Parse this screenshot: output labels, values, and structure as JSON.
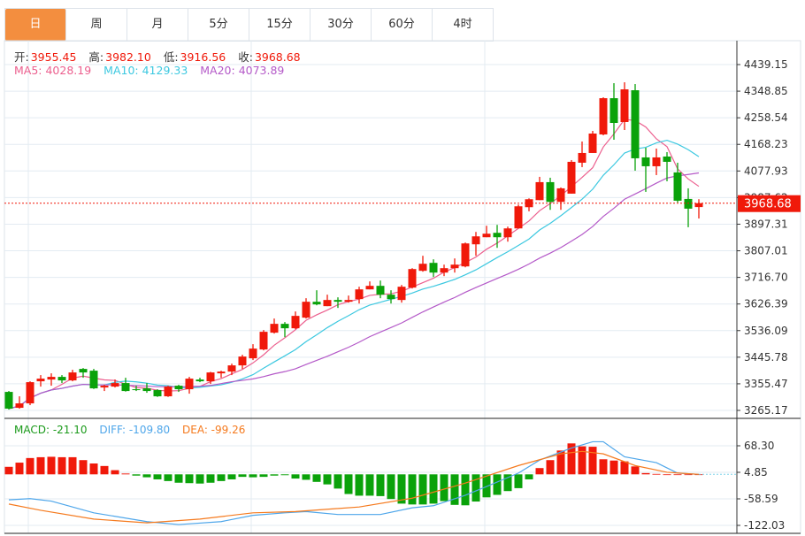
{
  "tabs": [
    "日",
    "周",
    "月",
    "5分",
    "15分",
    "30分",
    "60分",
    "4时"
  ],
  "active_tab": 0,
  "ohlc_legend": {
    "open_label": "开:",
    "open": "3955.45",
    "high_label": "高:",
    "high": "3982.10",
    "low_label": "低:",
    "low": "3916.56",
    "close_label": "收:",
    "close": "3968.68"
  },
  "ma_legend": {
    "ma5": "MA5: 4028.19",
    "ma10": "MA10: 4129.33",
    "ma20": "MA20: 4073.89"
  },
  "macd_legend": {
    "macd": "MACD: -21.10",
    "diff": "DIFF: -109.80",
    "dea": "DEA: -99.26"
  },
  "colors": {
    "up": "#f0190a",
    "down": "#0aa20a",
    "ma5": "#ec5f8e",
    "ma10": "#3cc8e0",
    "ma20": "#b459c8",
    "diff": "#4ea6ea",
    "dea": "#f57a1e",
    "active_tab": "#f38e3f"
  },
  "chart_data": {
    "type": "candlestick",
    "price_axis_ticks": [
      "4439.15",
      "4348.85",
      "4258.54",
      "4168.23",
      "4077.93",
      "3987.62",
      "3897.31",
      "3807.01",
      "3716.70",
      "3626.39",
      "3536.09",
      "3445.78",
      "3355.47",
      "3265.17"
    ],
    "price_range": [
      3265.17,
      4439.15
    ],
    "current_price": "3968.68",
    "candles": [
      [
        3328,
        3271,
        3331,
        3268
      ],
      [
        3274,
        3289,
        3313,
        3271
      ],
      [
        3289,
        3361,
        3364,
        3283
      ],
      [
        3364,
        3373,
        3385,
        3346
      ],
      [
        3370,
        3379,
        3391,
        3349
      ],
      [
        3379,
        3367,
        3385,
        3358
      ],
      [
        3367,
        3394,
        3403,
        3364
      ],
      [
        3406,
        3394,
        3409,
        3376
      ],
      [
        3400,
        3340,
        3406,
        3338
      ],
      [
        3343,
        3349,
        3352,
        3331
      ],
      [
        3346,
        3358,
        3370,
        3343
      ],
      [
        3358,
        3331,
        3376,
        3329
      ],
      [
        3337,
        3334,
        3349,
        3331
      ],
      [
        3340,
        3331,
        3358,
        3325
      ],
      [
        3334,
        3313,
        3337,
        3311
      ],
      [
        3313,
        3346,
        3349,
        3311
      ],
      [
        3349,
        3337,
        3352,
        3328
      ],
      [
        3337,
        3373,
        3379,
        3322
      ],
      [
        3370,
        3364,
        3376,
        3361
      ],
      [
        3364,
        3394,
        3396,
        3355
      ],
      [
        3391,
        3397,
        3400,
        3376
      ],
      [
        3397,
        3418,
        3424,
        3385
      ],
      [
        3418,
        3448,
        3454,
        3406
      ],
      [
        3442,
        3475,
        3490,
        3436
      ],
      [
        3472,
        3532,
        3538,
        3469
      ],
      [
        3529,
        3559,
        3577,
        3526
      ],
      [
        3559,
        3544,
        3565,
        3514
      ],
      [
        3544,
        3586,
        3601,
        3541
      ],
      [
        3580,
        3634,
        3646,
        3577
      ],
      [
        3634,
        3625,
        3673,
        3622
      ],
      [
        3619,
        3640,
        3658,
        3619
      ],
      [
        3640,
        3634,
        3649,
        3613
      ],
      [
        3634,
        3640,
        3655,
        3631
      ],
      [
        3643,
        3676,
        3685,
        3628
      ],
      [
        3676,
        3688,
        3703,
        3676
      ],
      [
        3688,
        3658,
        3706,
        3646
      ],
      [
        3658,
        3643,
        3673,
        3628
      ],
      [
        3640,
        3685,
        3691,
        3631
      ],
      [
        3682,
        3745,
        3748,
        3679
      ],
      [
        3739,
        3763,
        3790,
        3736
      ],
      [
        3766,
        3733,
        3778,
        3718
      ],
      [
        3733,
        3748,
        3760,
        3721
      ],
      [
        3748,
        3760,
        3781,
        3733
      ],
      [
        3754,
        3832,
        3835,
        3751
      ],
      [
        3829,
        3856,
        3871,
        3790
      ],
      [
        3853,
        3865,
        3892,
        3853
      ],
      [
        3868,
        3853,
        3895,
        3817
      ],
      [
        3853,
        3883,
        3889,
        3838
      ],
      [
        3883,
        3958,
        3964,
        3883
      ],
      [
        3955,
        3982,
        3985,
        3941
      ],
      [
        3979,
        4040,
        4058,
        3979
      ],
      [
        4040,
        3973,
        4055,
        3946
      ],
      [
        3973,
        4019,
        4022,
        3946
      ],
      [
        4001,
        4109,
        4115,
        4001
      ],
      [
        4106,
        4139,
        4178,
        4091
      ],
      [
        4139,
        4205,
        4214,
        4139
      ],
      [
        4202,
        4325,
        4328,
        4199
      ],
      [
        4325,
        4241,
        4376,
        4184
      ],
      [
        4244,
        4355,
        4379,
        4217
      ],
      [
        4352,
        4121,
        4373,
        4079
      ],
      [
        4124,
        4094,
        4157,
        4007
      ],
      [
        4094,
        4124,
        4154,
        4064
      ],
      [
        4127,
        4109,
        4142,
        4043
      ],
      [
        4073,
        3977,
        4106,
        3971
      ],
      [
        3983,
        3950,
        4019,
        3887
      ],
      [
        3955.45,
        3968.68,
        3982.1,
        3916.56
      ]
    ],
    "candle_format": [
      "open",
      "close",
      "high",
      "low"
    ],
    "moving_averages": [
      5,
      10,
      20
    ],
    "macd_axis_ticks": [
      "68.30",
      "4.85",
      "-58.59",
      "-122.03"
    ],
    "macd_histogram": [
      18,
      28,
      39,
      41,
      42,
      41,
      41,
      34,
      26,
      20,
      10,
      2,
      -3,
      -7,
      -12,
      -16,
      -20,
      -21,
      -22,
      -20,
      -16,
      -12,
      -6,
      -7,
      -6,
      -3,
      -2,
      -10,
      -13,
      -18,
      -24,
      -34,
      -47,
      -51,
      -51,
      -52,
      -59,
      -70,
      -72,
      -72,
      -70,
      -64,
      -73,
      -74,
      -65,
      -55,
      -49,
      -40,
      -33,
      -12,
      15,
      34,
      57,
      74,
      67,
      66,
      36,
      33,
      31,
      19,
      3,
      1,
      0,
      0,
      0,
      0
    ],
    "diff_points": [
      [
        0,
        -61
      ],
      [
        2,
        -58
      ],
      [
        4,
        -64
      ],
      [
        8,
        -92
      ],
      [
        13,
        -113
      ],
      [
        16,
        -120
      ],
      [
        20,
        -113
      ],
      [
        23,
        -98
      ],
      [
        26,
        -92
      ],
      [
        28,
        -89
      ],
      [
        31,
        -96
      ],
      [
        35,
        -96
      ],
      [
        38,
        -80
      ],
      [
        40,
        -75
      ],
      [
        43,
        -50
      ],
      [
        45,
        -29
      ],
      [
        48,
        3
      ],
      [
        50,
        34
      ],
      [
        53,
        63
      ],
      [
        55,
        78
      ],
      [
        56,
        78
      ],
      [
        58,
        42
      ],
      [
        61,
        28
      ],
      [
        63,
        3
      ],
      [
        65,
        0
      ]
    ],
    "dea_points": [
      [
        0,
        -71
      ],
      [
        3,
        -86
      ],
      [
        8,
        -107
      ],
      [
        13,
        -116
      ],
      [
        18,
        -107
      ],
      [
        23,
        -92
      ],
      [
        27,
        -89
      ],
      [
        33,
        -78
      ],
      [
        38,
        -57
      ],
      [
        43,
        -21
      ],
      [
        48,
        21
      ],
      [
        52,
        49
      ],
      [
        54,
        55
      ],
      [
        56,
        49
      ],
      [
        59,
        21
      ],
      [
        62,
        5
      ],
      [
        65,
        0
      ]
    ]
  }
}
